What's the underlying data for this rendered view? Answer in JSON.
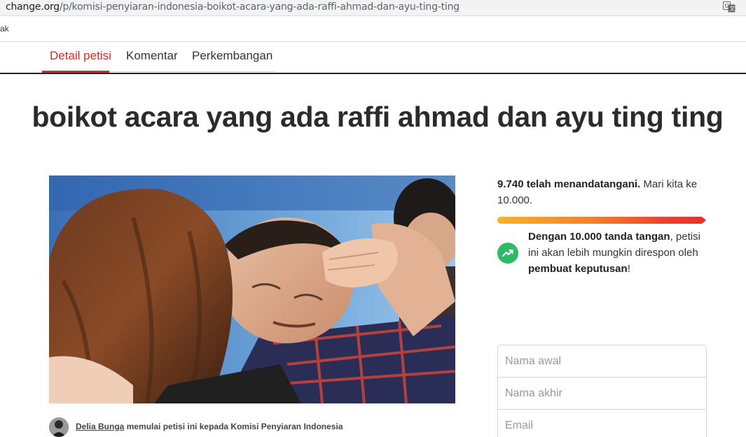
{
  "browser": {
    "url_host": "change.org",
    "url_path": "/p/komisi-penyiaran-indonesia-boikot-acara-yang-ada-raffi-ahmad-dan-ayu-ting-ting",
    "bookmark_text": "ak"
  },
  "tabs": [
    {
      "label": "Detail petisi",
      "active": true
    },
    {
      "label": "Komentar",
      "active": false
    },
    {
      "label": "Perkembangan",
      "active": false
    }
  ],
  "petition": {
    "title": "boikot acara yang ada raffi ahmad dan ayu ting ting",
    "starter_name": "Delia Bunga",
    "starter_text": " memulai petisi ini kepada Komisi Penyiaran Indonesia"
  },
  "signatures": {
    "count_text": "9.740 telah menandatangani.",
    "goal_text": " Mari kita ke 10.000.",
    "progress_fraction": 0.974,
    "goal_bold_1": "Dengan 10.000 tanda tangan",
    "goal_mid": ", petisi ini akan lebih mungkin direspon oleh ",
    "goal_bold_2": "pembuat keputusan",
    "goal_end": "!"
  },
  "form": {
    "first_name_placeholder": "Nama awal",
    "last_name_placeholder": "Nama akhir",
    "email_placeholder": "Email"
  },
  "colors": {
    "accent": "#c9302c",
    "trend_green": "#2dbb63"
  }
}
